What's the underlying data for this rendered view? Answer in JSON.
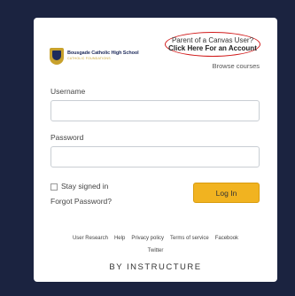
{
  "header": {
    "school_name": "Bousgade Catholic High School",
    "school_tagline": "CATHOLIC FOUNDATIONS",
    "parent_line1": "Parent of a Canvas User?",
    "parent_line2": "Click Here For an Account",
    "browse_courses": "Browse courses"
  },
  "form": {
    "username_label": "Username",
    "username_value": "",
    "password_label": "Password",
    "password_value": "",
    "stay_signed_in": "Stay signed in",
    "stay_signed_in_checked": false,
    "forgot_password": "Forgot Password?",
    "login_label": "Log In"
  },
  "footer": {
    "links": [
      "User Research",
      "Help",
      "Privacy policy",
      "Terms of service",
      "Facebook"
    ],
    "twitter": "Twitter",
    "by_instructure": "BY INSTRUCTURE"
  },
  "colors": {
    "background": "#1b2340",
    "login_button": "#f1b320",
    "highlight_circle": "#d11a1a"
  }
}
